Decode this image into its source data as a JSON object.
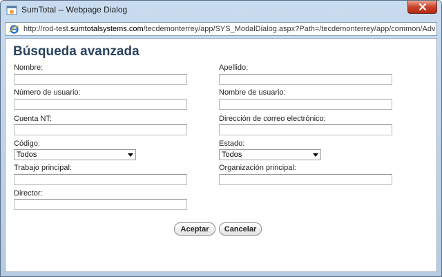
{
  "window": {
    "title": "SumTotal -- Webpage Dialog",
    "address_prefix": "http://rod-test.",
    "address_domain": "sumtotalsystems.com",
    "address_rest": "/tecdemonterrey/app/SYS_ModalDialog.aspx?Path=/tecdemonterrey/app/common/AdvancedSearch.aspx%"
  },
  "page": {
    "title": "Búsqueda avanzada"
  },
  "fields": {
    "nombre": {
      "label": "Nombre:",
      "value": ""
    },
    "apellido": {
      "label": "Apellido:",
      "value": ""
    },
    "numero_usuario": {
      "label": "Número de usuario:",
      "value": ""
    },
    "nombre_usuario": {
      "label": "Nombre de usuario:",
      "value": ""
    },
    "cuenta_nt": {
      "label": "Cuenta NT:",
      "value": ""
    },
    "correo": {
      "label": "Dirección de correo electrónico:",
      "value": ""
    },
    "codigo": {
      "label": "Código:",
      "selected": "Todos"
    },
    "estado": {
      "label": "Estado:",
      "selected": "Todos"
    },
    "trabajo": {
      "label": "Trabajo principal:",
      "value": ""
    },
    "organizacion": {
      "label": "Organización principal:",
      "value": ""
    },
    "director": {
      "label": "Director:",
      "value": ""
    }
  },
  "buttons": {
    "accept": "Aceptar",
    "cancel": "Cancelar"
  },
  "colors": {
    "title": "#2c4462",
    "close": "#c9432a"
  },
  "icons": {
    "window": "sumtotal-window-icon",
    "close": "close-icon",
    "browser": "ie-icon",
    "dropdown": "chevron-down-icon"
  }
}
